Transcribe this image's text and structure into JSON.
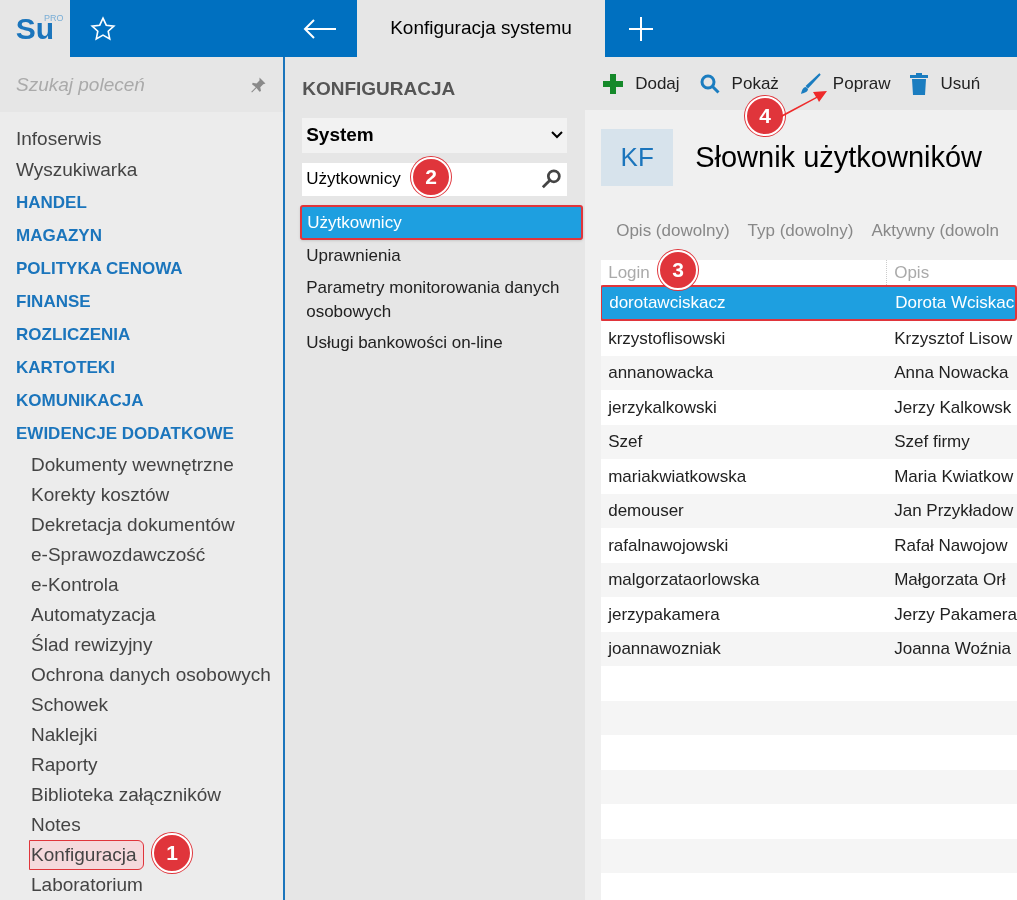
{
  "logo": {
    "text": "Su",
    "superscript": "PRO"
  },
  "tab": {
    "title": "Konfiguracja systemu"
  },
  "command_search": {
    "placeholder": "Szukaj poleceń"
  },
  "sidebar": {
    "items": [
      {
        "label": "Infoserwis",
        "kind": "link",
        "selected": false
      },
      {
        "label": "Wyszukiwarka",
        "kind": "link",
        "selected": false
      },
      {
        "label": "HANDEL",
        "kind": "section",
        "selected": false
      },
      {
        "label": "MAGAZYN",
        "kind": "section",
        "selected": false
      },
      {
        "label": "POLITYKA CENOWA",
        "kind": "section",
        "selected": false
      },
      {
        "label": "FINANSE",
        "kind": "section",
        "selected": false
      },
      {
        "label": "ROZLICZENIA",
        "kind": "section",
        "selected": false
      },
      {
        "label": "KARTOTEKI",
        "kind": "section",
        "selected": false
      },
      {
        "label": "KOMUNIKACJA",
        "kind": "section",
        "selected": false
      },
      {
        "label": "EWIDENCJE DODATKOWE",
        "kind": "section",
        "selected": false
      },
      {
        "label": "Dokumenty wewnętrzne",
        "kind": "sub",
        "selected": false
      },
      {
        "label": "Korekty kosztów",
        "kind": "sub",
        "selected": false
      },
      {
        "label": "Dekretacja dokumentów",
        "kind": "sub",
        "selected": false
      },
      {
        "label": "e-Sprawozdawczość",
        "kind": "sub",
        "selected": false
      },
      {
        "label": "e-Kontrola",
        "kind": "sub",
        "selected": false
      },
      {
        "label": "Automatyzacja",
        "kind": "sub",
        "selected": false
      },
      {
        "label": "Ślad rewizyjny",
        "kind": "sub",
        "selected": false
      },
      {
        "label": "Ochrona danych osobowych",
        "kind": "sub",
        "selected": false
      },
      {
        "label": "Schowek",
        "kind": "sub",
        "selected": false
      },
      {
        "label": "Naklejki",
        "kind": "sub",
        "selected": false
      },
      {
        "label": "Raporty",
        "kind": "sub",
        "selected": false
      },
      {
        "label": "Biblioteka załączników",
        "kind": "sub",
        "selected": false
      },
      {
        "label": "Notes",
        "kind": "sub",
        "selected": false
      },
      {
        "label": "Konfiguracja",
        "kind": "sub",
        "selected": true
      },
      {
        "label": "Laboratorium",
        "kind": "sub",
        "selected": false
      }
    ]
  },
  "config_panel": {
    "title": "KONFIGURACJA",
    "group_select": "System",
    "search_value": "Użytkownicy",
    "items": [
      {
        "label": "Użytkownicy",
        "selected": true
      },
      {
        "label": "Uprawnienia",
        "selected": false
      },
      {
        "label": "Parametry monitorowania danych osobowych",
        "selected": false
      },
      {
        "label": "Usługi bankowości on-line",
        "selected": false
      }
    ]
  },
  "toolbar": {
    "buttons": [
      {
        "label": "Dodaj",
        "kind": "add"
      },
      {
        "label": "Pokaż",
        "kind": "show"
      },
      {
        "label": "Popraw",
        "kind": "edit"
      },
      {
        "label": "Usuń",
        "kind": "delete"
      }
    ]
  },
  "dictionary": {
    "badge": "KF",
    "title": "Słownik użytkowników",
    "filters": [
      "Opis (dowolny)",
      "Typ (dowolny)",
      "Aktywny (dowoln"
    ],
    "columns": [
      "Login",
      "Opis"
    ],
    "rows": [
      {
        "cells": [
          "dorotawciskacz",
          "Dorota Wciskac"
        ],
        "selected": true
      },
      {
        "cells": [
          "krzystoflisowski",
          "Krzysztof Lisow"
        ],
        "selected": false
      },
      {
        "cells": [
          "annanowacka",
          "Anna Nowacka"
        ],
        "selected": false
      },
      {
        "cells": [
          "jerzykalkowski",
          "Jerzy Kalkowsk"
        ],
        "selected": false
      },
      {
        "cells": [
          "Szef",
          "Szef firmy"
        ],
        "selected": false
      },
      {
        "cells": [
          "mariakwiatkowska",
          "Maria Kwiatkow"
        ],
        "selected": false
      },
      {
        "cells": [
          "demouser",
          "Jan Przykładow"
        ],
        "selected": false
      },
      {
        "cells": [
          "rafalnawojowski",
          "Rafał Nawojow"
        ],
        "selected": false
      },
      {
        "cells": [
          "malgorzataorlowska",
          "Małgorzata Orł"
        ],
        "selected": false
      },
      {
        "cells": [
          "jerzypakamera",
          "Jerzy Pakamera"
        ],
        "selected": false
      },
      {
        "cells": [
          "joannawozniak",
          "Joanna Woźnia"
        ],
        "selected": false
      }
    ]
  },
  "callouts": [
    "1",
    "2",
    "3",
    "4"
  ]
}
